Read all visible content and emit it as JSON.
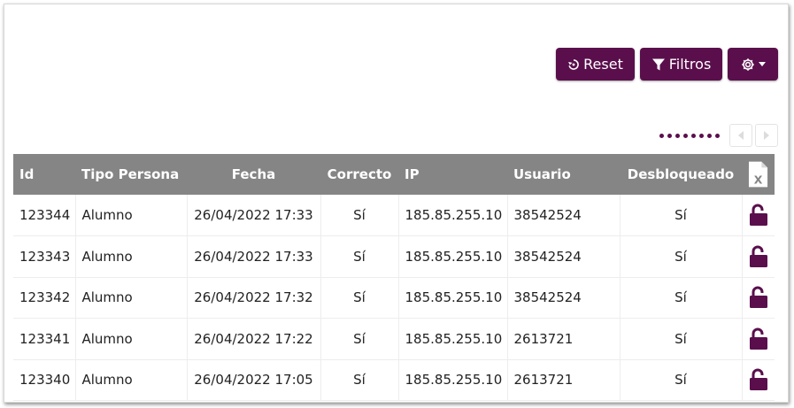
{
  "toolbar": {
    "reset_label": "Reset",
    "filtros_label": "Filtros",
    "accent_color": "#5a0f4c"
  },
  "pager": {
    "dot_count": 8,
    "prev_icon": "caret-left-icon",
    "next_icon": "caret-right-icon"
  },
  "table": {
    "columns": [
      "Id",
      "Tipo Persona",
      "Fecha",
      "Correcto",
      "IP",
      "Usuario",
      "Desbloqueado"
    ],
    "export_icon": "excel-file-icon",
    "row_icon": "unlock-icon",
    "rows": [
      {
        "id": "123344",
        "tipo": "Alumno",
        "fecha": "26/04/2022 17:33",
        "correcto": "Sí",
        "ip": "185.85.255.10",
        "usuario": "38542524",
        "desbloqueado": "Sí"
      },
      {
        "id": "123343",
        "tipo": "Alumno",
        "fecha": "26/04/2022 17:33",
        "correcto": "Sí",
        "ip": "185.85.255.10",
        "usuario": "38542524",
        "desbloqueado": "Sí"
      },
      {
        "id": "123342",
        "tipo": "Alumno",
        "fecha": "26/04/2022 17:32",
        "correcto": "Sí",
        "ip": "185.85.255.10",
        "usuario": "38542524",
        "desbloqueado": "Sí"
      },
      {
        "id": "123341",
        "tipo": "Alumno",
        "fecha": "26/04/2022 17:22",
        "correcto": "Sí",
        "ip": "185.85.255.10",
        "usuario": "2613721",
        "desbloqueado": "Sí"
      },
      {
        "id": "123340",
        "tipo": "Alumno",
        "fecha": "26/04/2022 17:05",
        "correcto": "Sí",
        "ip": "185.85.255.10",
        "usuario": "2613721",
        "desbloqueado": "Sí"
      }
    ]
  }
}
